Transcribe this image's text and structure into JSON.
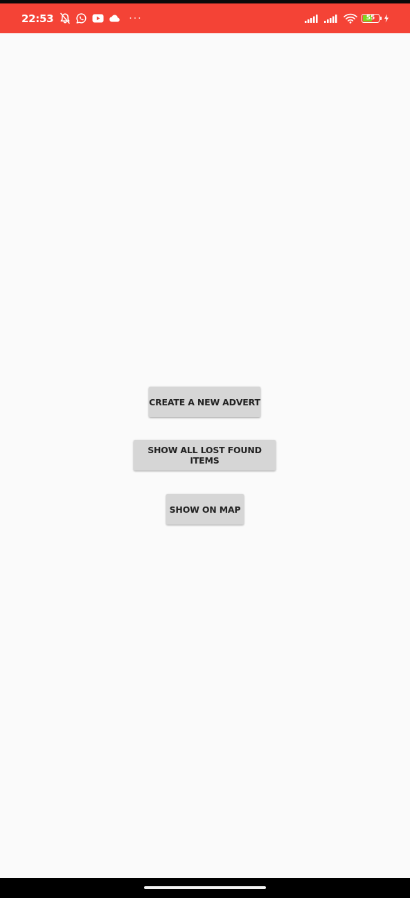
{
  "status_bar": {
    "time": "22:53",
    "battery_level": "55",
    "overflow_indicator": "···",
    "background_color": "#f44336",
    "left_icons": [
      "notifications-off-icon",
      "whatsapp-icon",
      "youtube-icon",
      "cloud-icon"
    ],
    "right_icons": [
      "signal-1-icon",
      "signal-2-icon",
      "wifi-icon",
      "battery-icon",
      "charging-icon"
    ]
  },
  "main": {
    "background_color": "#fafafa",
    "buttons": [
      {
        "label": "CREATE A NEW ADVERT"
      },
      {
        "label": "SHOW ALL LOST FOUND ITEMS"
      },
      {
        "label": "SHOW ON MAP"
      }
    ],
    "button_color": "#d6d6d6"
  },
  "nav_bar": {
    "home_indicator": "home-indicator"
  }
}
